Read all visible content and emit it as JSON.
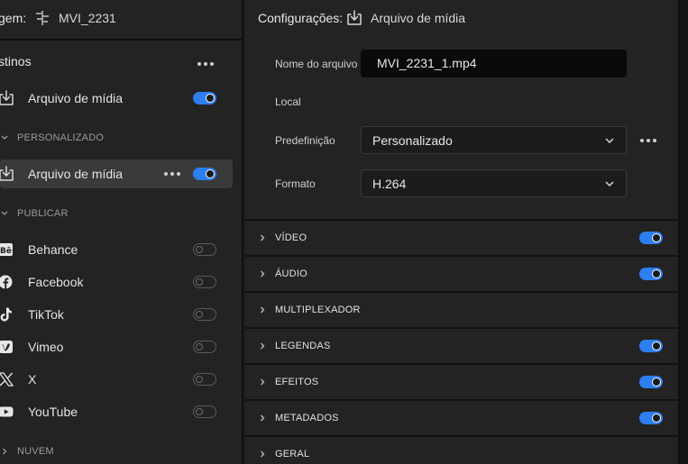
{
  "source": {
    "label": "gem:",
    "file_name": "MVI_2231",
    "icon": "timeline-icon"
  },
  "destinations": {
    "title": "stinos",
    "top_item": {
      "label": "Arquivo de mídia",
      "icon": "download-icon",
      "enabled": true
    },
    "sections": [
      {
        "label": "PERSONALIZADO",
        "items": [
          {
            "label": "Arquivo de mídia",
            "icon": "download-icon",
            "enabled": true,
            "selected": true
          }
        ]
      },
      {
        "label": "PUBLICAR",
        "items": [
          {
            "label": "Behance",
            "icon": "behance-icon",
            "enabled": false
          },
          {
            "label": "Facebook",
            "icon": "facebook-icon",
            "enabled": false
          },
          {
            "label": "TikTok",
            "icon": "tiktok-icon",
            "enabled": false
          },
          {
            "label": "Vimeo",
            "icon": "vimeo-icon",
            "enabled": false
          },
          {
            "label": "X",
            "icon": "x-icon",
            "enabled": false
          },
          {
            "label": "YouTube",
            "icon": "youtube-icon",
            "enabled": false
          }
        ]
      },
      {
        "label": "NUVEM",
        "items": []
      }
    ]
  },
  "settings": {
    "title": "Configurações:",
    "target": "Arquivo de mídia",
    "fields": {
      "file_name": {
        "label": "Nome do arquivo",
        "value": "MVI_2231_1.mp4"
      },
      "location": {
        "label": "Local"
      },
      "preset": {
        "label": "Predefinição",
        "value": "Personalizado"
      },
      "format": {
        "label": "Formato",
        "value": "H.264"
      }
    },
    "accordions": [
      {
        "label": "VÍDEO",
        "toggle": true,
        "enabled": true
      },
      {
        "label": "ÁUDIO",
        "toggle": true,
        "enabled": true
      },
      {
        "label": "MULTIPLEXADOR",
        "toggle": false
      },
      {
        "label": "LEGENDAS",
        "toggle": true,
        "enabled": true
      },
      {
        "label": "EFEITOS",
        "toggle": true,
        "enabled": true
      },
      {
        "label": "METADADOS",
        "toggle": true,
        "enabled": true
      },
      {
        "label": "GERAL",
        "toggle": false
      }
    ]
  },
  "colors": {
    "accent": "#2d7ff0",
    "panel": "#232323",
    "selected_row": "#3a3a3a"
  }
}
